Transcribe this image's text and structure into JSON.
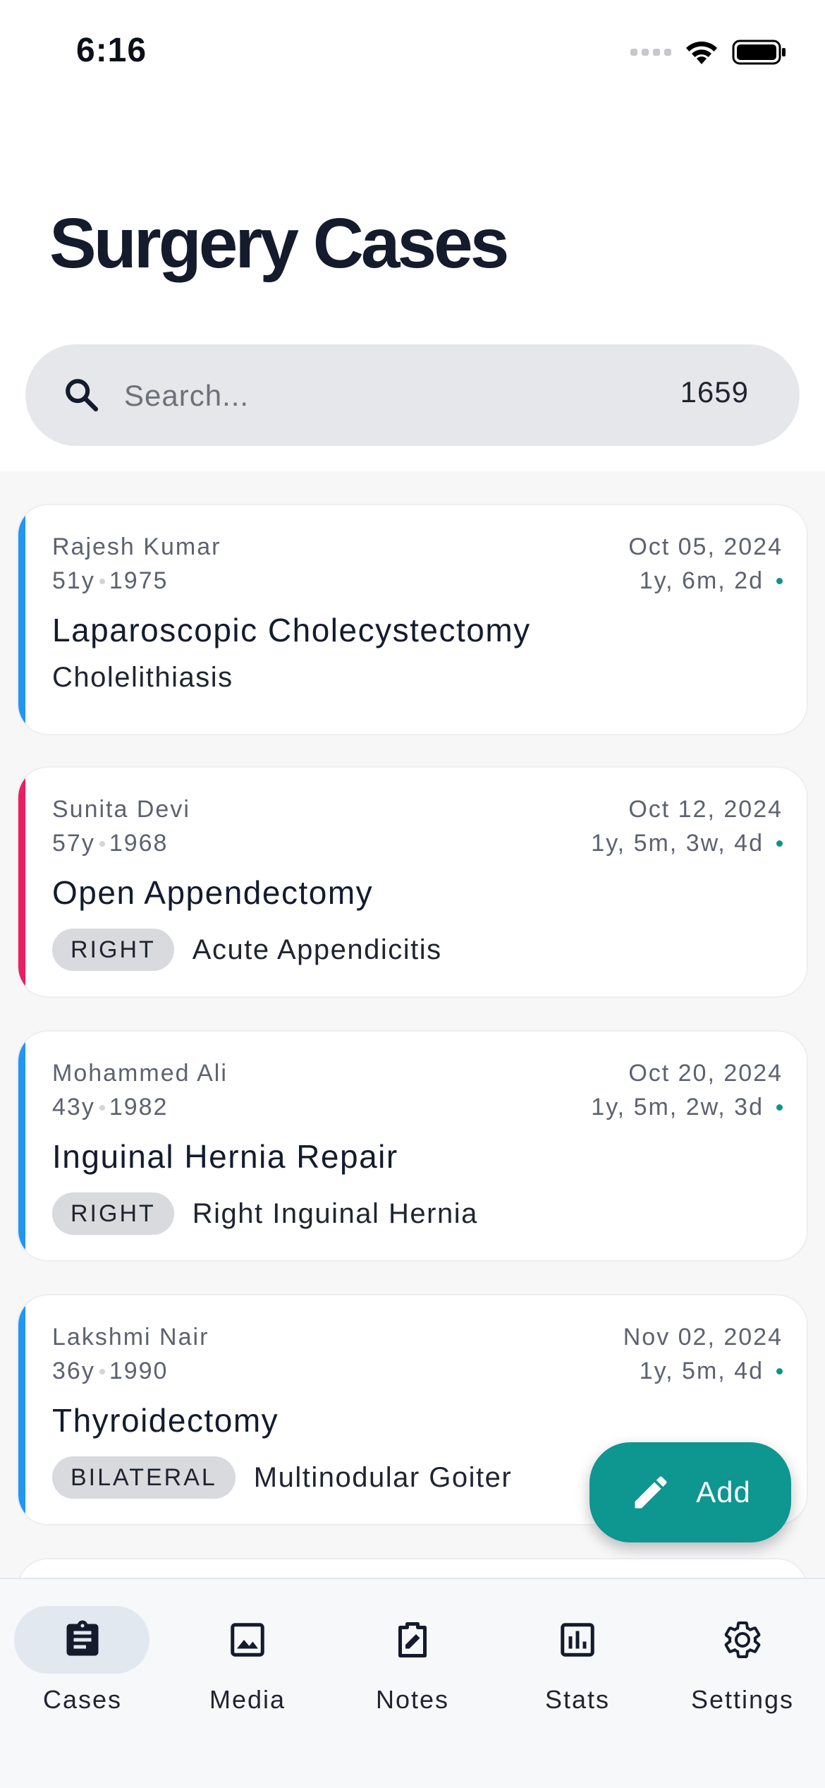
{
  "status_bar": {
    "time": "6:16"
  },
  "header": {
    "title": "Surgery Cases"
  },
  "search": {
    "placeholder": "Search...",
    "value": "",
    "count": "1659"
  },
  "cases": [
    {
      "patient": "Rajesh Kumar",
      "age": "51y",
      "birth_year": "1975",
      "date": "Oct 05, 2024",
      "elapsed": "1y, 6m, 2d",
      "procedure": "Laparoscopic Cholecystectomy",
      "side": "",
      "diagnosis": "Cholelithiasis",
      "accent": "#2196f3"
    },
    {
      "patient": "Sunita Devi",
      "age": "57y",
      "birth_year": "1968",
      "date": "Oct 12, 2024",
      "elapsed": "1y, 5m, 3w, 4d",
      "procedure": "Open Appendectomy",
      "side": "RIGHT",
      "diagnosis": "Acute Appendicitis",
      "accent": "#e91e63"
    },
    {
      "patient": "Mohammed Ali",
      "age": "43y",
      "birth_year": "1982",
      "date": "Oct 20, 2024",
      "elapsed": "1y, 5m, 2w, 3d",
      "procedure": "Inguinal Hernia Repair",
      "side": "RIGHT",
      "diagnosis": "Right Inguinal Hernia",
      "accent": "#2196f3"
    },
    {
      "patient": "Lakshmi Nair",
      "age": "36y",
      "birth_year": "1990",
      "date": "Nov 02, 2024",
      "elapsed": "1y, 5m, 4d",
      "procedure": "Thyroidectomy",
      "side": "BILATERAL",
      "diagnosis": "Multinodular Goiter",
      "accent": "#2196f3"
    }
  ],
  "fab": {
    "label": "Add",
    "icon": "pencil-icon",
    "color": "#0e9691"
  },
  "nav": {
    "items": [
      {
        "label": "Cases",
        "icon": "clipboard-icon",
        "active": true
      },
      {
        "label": "Media",
        "icon": "image-icon",
        "active": false
      },
      {
        "label": "Notes",
        "icon": "edit-note-icon",
        "active": false
      },
      {
        "label": "Stats",
        "icon": "bar-chart-icon",
        "active": false
      },
      {
        "label": "Settings",
        "icon": "gear-icon",
        "active": false
      }
    ]
  },
  "colors": {
    "accent_teal": "#0d9488",
    "search_bg": "#e6e7ea",
    "nav_active_pill": "#e2e8f0"
  }
}
